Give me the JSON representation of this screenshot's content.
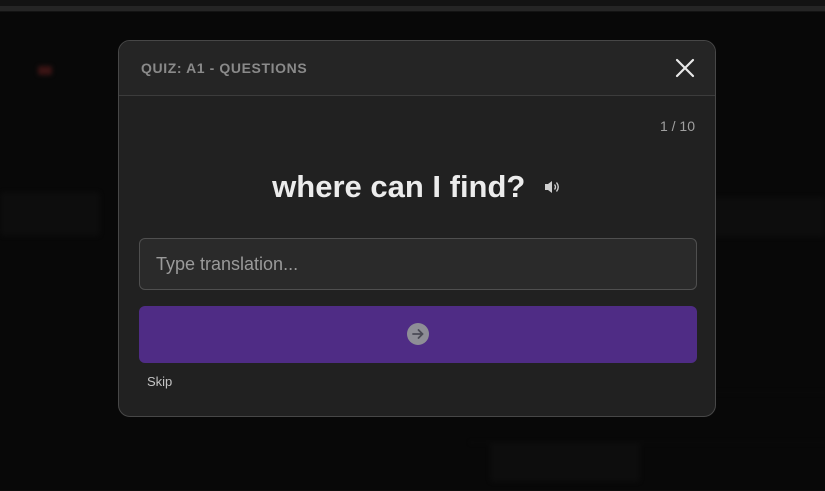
{
  "background": {
    "left_items": [
      "",
      "",
      "",
      "",
      "",
      "",
      ""
    ],
    "right_items": [
      "",
      ""
    ]
  },
  "modal": {
    "title": "QUIZ: A1 - QUESTIONS",
    "close_icon": "close-icon",
    "progress": "1 / 10",
    "question": "where can I find?",
    "speaker_icon": "speaker-icon",
    "answer": {
      "value": "",
      "placeholder": "Type translation..."
    },
    "submit_icon": "arrow-right-circle-icon",
    "skip_label": "Skip"
  },
  "colors": {
    "modal_bg": "#212121",
    "submit_bg": "#4f2c85",
    "title": "#8a8a8a"
  }
}
